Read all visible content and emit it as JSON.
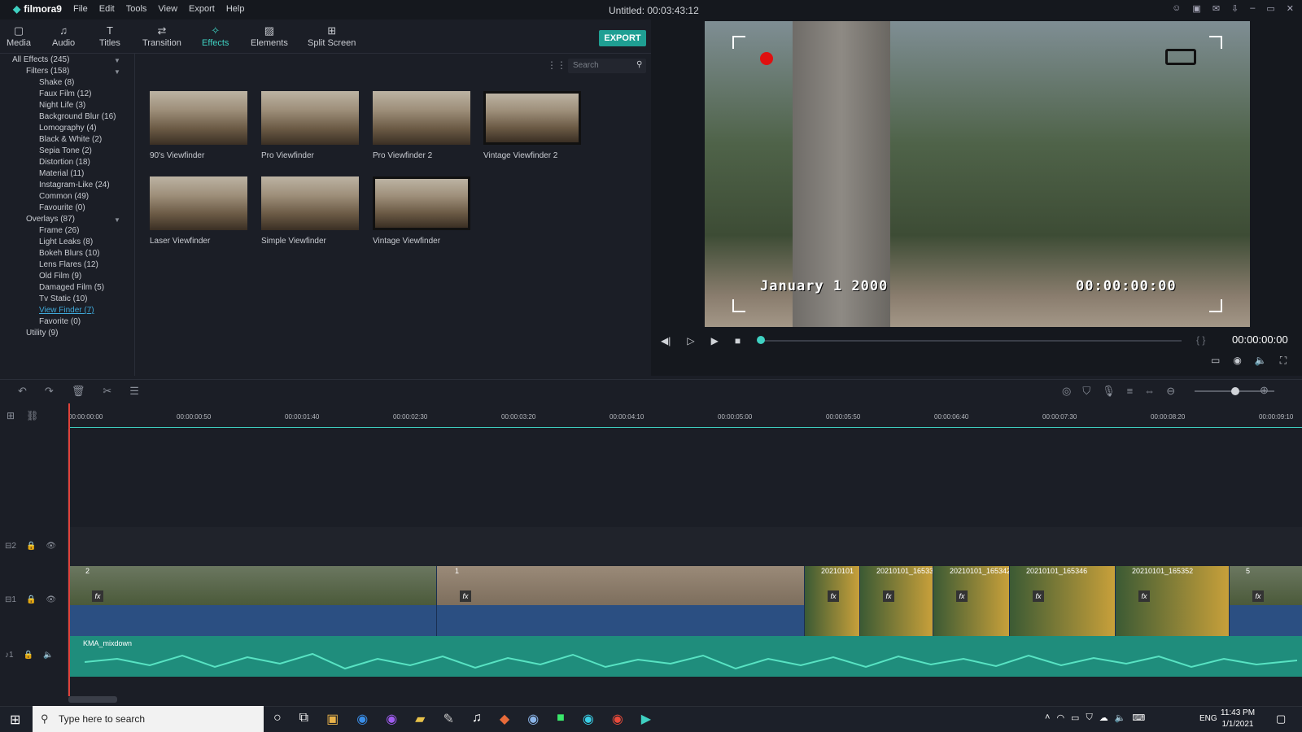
{
  "app": {
    "name": "filmora9",
    "title": "Untitled:",
    "duration": "00:03:43:12"
  },
  "menu": [
    "File",
    "Edit",
    "Tools",
    "View",
    "Export",
    "Help"
  ],
  "tabs": [
    {
      "label": "Media",
      "icon": "folder-icon"
    },
    {
      "label": "Audio",
      "icon": "music-note-icon"
    },
    {
      "label": "Titles",
      "icon": "text-icon"
    },
    {
      "label": "Transition",
      "icon": "transition-icon"
    },
    {
      "label": "Effects",
      "icon": "effects-icon",
      "active": true
    },
    {
      "label": "Elements",
      "icon": "image-icon"
    },
    {
      "label": "Split Screen",
      "icon": "split-screen-icon"
    }
  ],
  "export_label": "EXPORT",
  "sidebar": [
    {
      "label": "All Effects (245)",
      "level": 0
    },
    {
      "label": "Filters (158)",
      "level": 1
    },
    {
      "label": "Shake (8)",
      "level": 2
    },
    {
      "label": "Faux Film (12)",
      "level": 2
    },
    {
      "label": "Night Life (3)",
      "level": 2
    },
    {
      "label": "Background Blur (16)",
      "level": 2
    },
    {
      "label": "Lomography (4)",
      "level": 2
    },
    {
      "label": "Black & White (2)",
      "level": 2
    },
    {
      "label": "Sepia Tone (2)",
      "level": 2
    },
    {
      "label": "Distortion (18)",
      "level": 2
    },
    {
      "label": "Material (11)",
      "level": 2
    },
    {
      "label": "Instagram-Like (24)",
      "level": 2
    },
    {
      "label": "Common (49)",
      "level": 2
    },
    {
      "label": "Favourite (0)",
      "level": 2
    },
    {
      "label": "Overlays (87)",
      "level": 1
    },
    {
      "label": "Frame (26)",
      "level": 2
    },
    {
      "label": "Light Leaks (8)",
      "level": 2
    },
    {
      "label": "Bokeh Blurs (10)",
      "level": 2
    },
    {
      "label": "Lens Flares (12)",
      "level": 2
    },
    {
      "label": "Old Film (9)",
      "level": 2
    },
    {
      "label": "Damaged Film (5)",
      "level": 2
    },
    {
      "label": "Tv Static (10)",
      "level": 2
    },
    {
      "label": "View Finder (7)",
      "level": 2,
      "selected": true
    },
    {
      "label": "Favorite (0)",
      "level": 2
    },
    {
      "label": "Utility (9)",
      "level": 1
    }
  ],
  "search_placeholder": "Search",
  "effects": [
    "90's Viewfinder",
    "Pro Viewfinder",
    "Pro Viewfinder 2",
    "Vintage Viewfinder 2",
    "Laser Viewfinder",
    "Simple Viewfinder",
    "Vintage Viewfinder"
  ],
  "preview": {
    "date": "January 1 2000",
    "overlay_time": "00:00:00:00",
    "timecode": "00:00:00:00"
  },
  "ruler": [
    "00:00:00:00",
    "00:00:00:50",
    "00:00:01:40",
    "00:00:02:30",
    "00:00:03:20",
    "00:00:04:10",
    "00:00:05:00",
    "00:00:05:50",
    "00:00:06:40",
    "00:00:07:30",
    "00:00:08:20",
    "00:00:09:10"
  ],
  "tracks": {
    "video2": "2",
    "video1": "1",
    "audio1": "1"
  },
  "clips": [
    "2",
    "1",
    "20210101",
    "20210101_16533",
    "20210101_165342",
    "20210101_165346",
    "20210101_165352",
    "5"
  ],
  "audio_clip": "KMA_mixdown",
  "taskbar": {
    "search": "Type here to search",
    "lang": "ENG",
    "time": "11:43 PM",
    "date": "1/1/2021"
  }
}
